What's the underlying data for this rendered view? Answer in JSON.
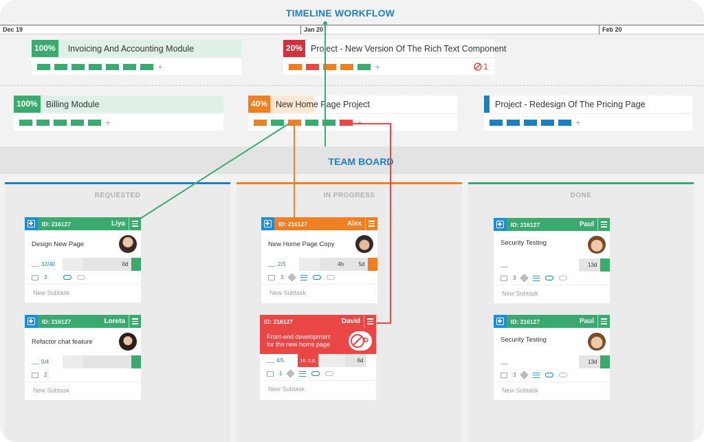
{
  "timeline": {
    "title": "TIMELINE WORKFLOW",
    "dates": [
      "Dec 19",
      "Jan 20",
      "Feb 20"
    ]
  },
  "projects": [
    {
      "pct": "100%",
      "name": "Invoicing And Accounting Module",
      "color": "#3aaa6e"
    },
    {
      "pct": "20%",
      "name": "Project - New Version Of The Rich Text Component",
      "color": "#d0313d",
      "blocked": "1"
    },
    {
      "pct": "100%",
      "name": "Billing Module",
      "color": "#3aaa6e"
    },
    {
      "pct": "40%",
      "name": "New Home Page Project",
      "color": "#f07f22"
    },
    {
      "pct": "",
      "name": "Project - Redesign Of The Pricing Page",
      "color": "#1b7fc1"
    }
  ],
  "team": {
    "title": "TEAM BOARD"
  },
  "columns": [
    {
      "label": "REQUESTED",
      "color": "#1b7fc1"
    },
    {
      "label": "IN PROGRESS",
      "color": "#f07f22"
    },
    {
      "label": "DONE",
      "color": "#3aaa6e"
    }
  ],
  "tasks": [
    {
      "id": "ID: 216127",
      "user": "Liya",
      "title": "Design New Page",
      "sub": "32/40",
      "t1": "",
      "t2": "0d",
      "comments": "3",
      "new": "New Subtask"
    },
    {
      "id": "ID: 216127",
      "user": "Loreta",
      "title": "Refactor chat feature",
      "sub": "0/4",
      "t1": "",
      "t2": "",
      "comments": "2",
      "new": "New Subtask"
    },
    {
      "id": "ID: 216127",
      "user": "Alex",
      "title": "New Home Page Copy",
      "sub": "2/3",
      "t1": "4h",
      "t2": "5d",
      "comments": "3",
      "new": "New Subtask"
    },
    {
      "id": "ID: 216127",
      "user": "David",
      "title": "Front-end development for the new home page",
      "sub": "4/5",
      "t1": "16 JUL",
      "t2": "6d",
      "comments": "1",
      "new": "New Subtask",
      "blocker": "D"
    },
    {
      "id": "ID: 216127",
      "user": "Paul",
      "title": "Security Testing",
      "sub": "",
      "t1": "",
      "t2": "13d",
      "comments": "3",
      "new": "New Subtask"
    },
    {
      "id": "ID: 216127",
      "user": "Paul",
      "title": "Security Testing",
      "sub": "",
      "t1": "",
      "t2": "13d",
      "comments": "3",
      "new": "New Subtask"
    }
  ],
  "colors": {
    "green": "#3aaa6e",
    "orange": "#f07f22",
    "red": "#ea4646",
    "blue": "#1b7fc1",
    "darkred": "#d0313d"
  }
}
